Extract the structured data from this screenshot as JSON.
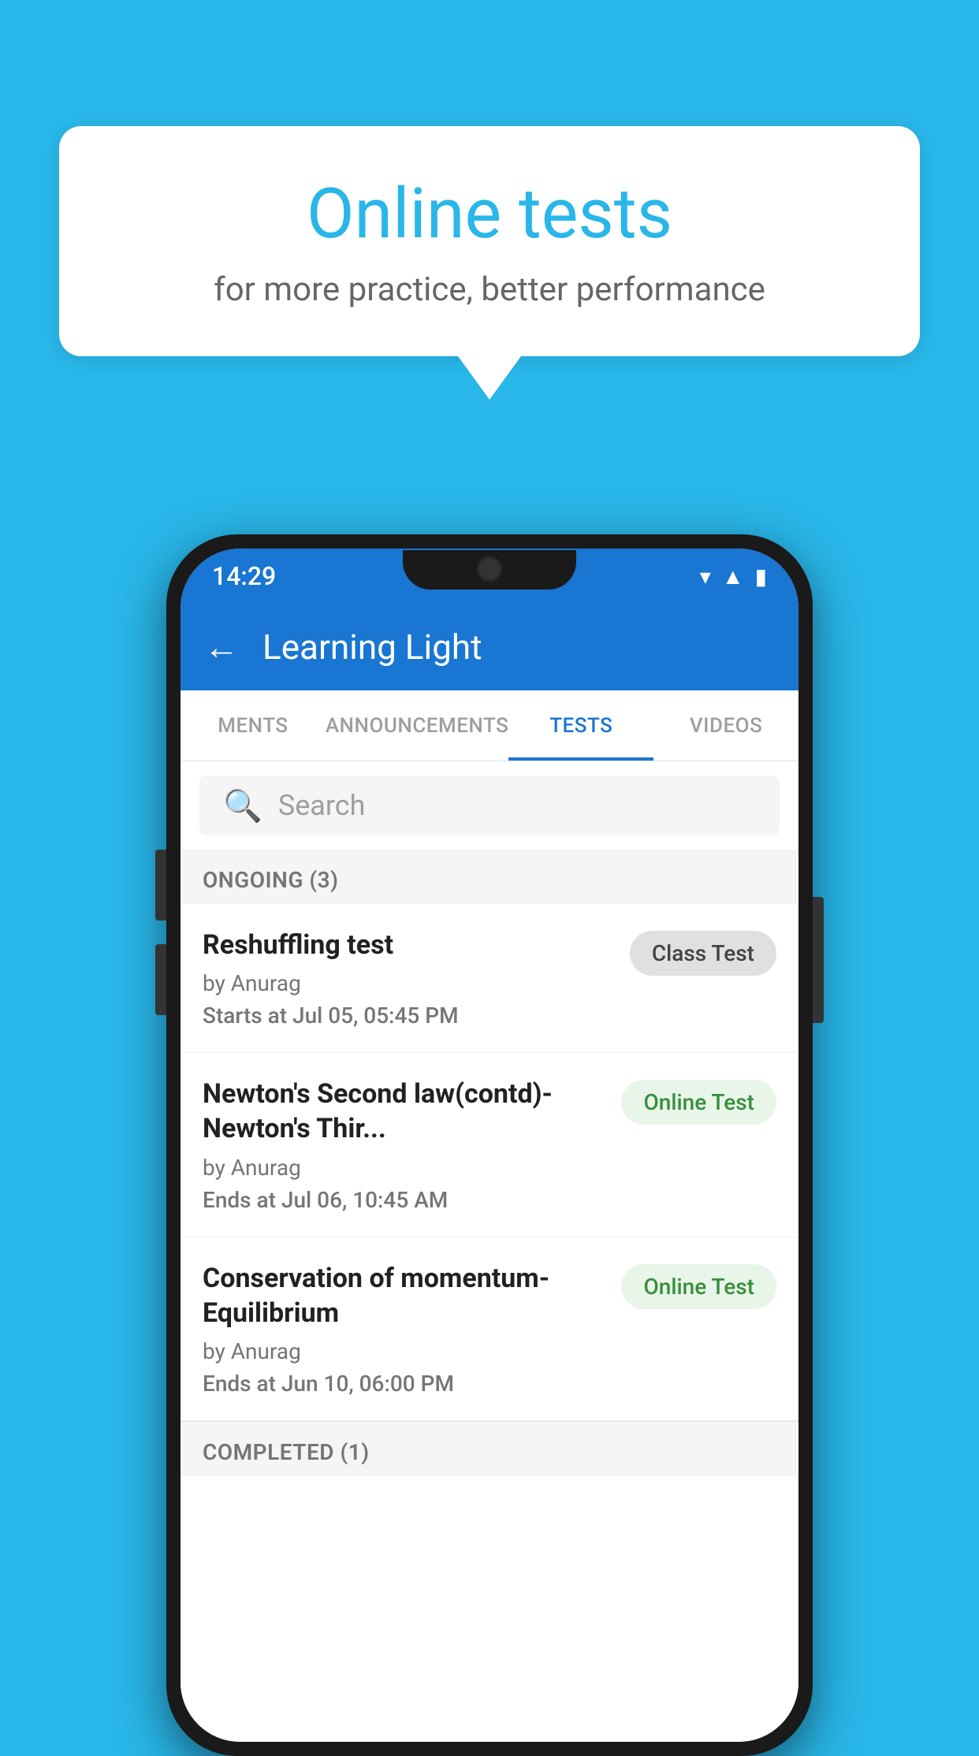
{
  "background": {
    "color": "#29b6e8"
  },
  "speech_bubble": {
    "title": "Online tests",
    "subtitle": "for more practice, better performance"
  },
  "phone": {
    "status_bar": {
      "time": "14:29"
    },
    "app_bar": {
      "back_label": "←",
      "title": "Learning Light"
    },
    "tabs": [
      {
        "label": "MENTS",
        "active": false
      },
      {
        "label": "ANNOUNCEMENTS",
        "active": false
      },
      {
        "label": "TESTS",
        "active": true
      },
      {
        "label": "VIDEOS",
        "active": false
      }
    ],
    "search": {
      "placeholder": "Search"
    },
    "ongoing_section": {
      "header": "ONGOING (3)"
    },
    "tests": [
      {
        "name": "Reshuffling test",
        "author": "by Anurag",
        "time_label": "Starts at",
        "time_value": "Jul 05, 05:45 PM",
        "badge": "Class Test",
        "badge_type": "class"
      },
      {
        "name": "Newton's Second law(contd)-Newton's Thir...",
        "author": "by Anurag",
        "time_label": "Ends at",
        "time_value": "Jul 06, 10:45 AM",
        "badge": "Online Test",
        "badge_type": "online"
      },
      {
        "name": "Conservation of momentum-Equilibrium",
        "author": "by Anurag",
        "time_label": "Ends at",
        "time_value": "Jun 10, 06:00 PM",
        "badge": "Online Test",
        "badge_type": "online"
      }
    ],
    "completed_section": {
      "header": "COMPLETED (1)"
    }
  }
}
